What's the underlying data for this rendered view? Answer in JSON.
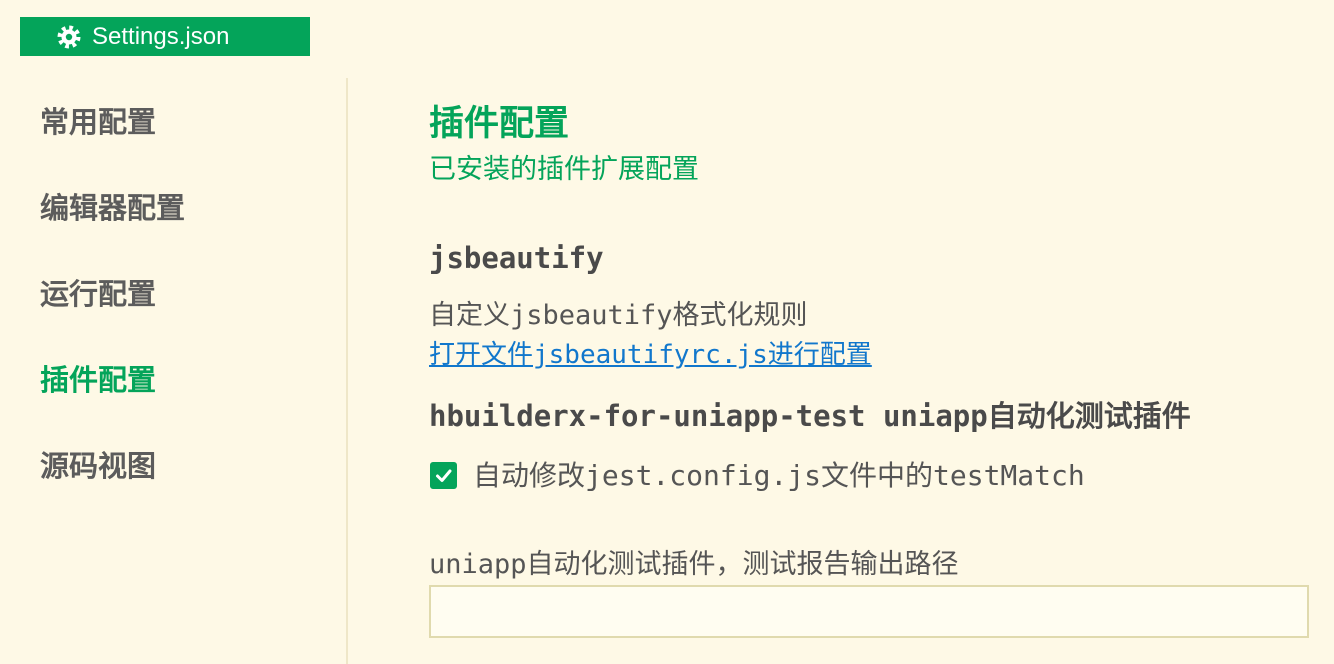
{
  "tab": {
    "title": "Settings.json",
    "icon": "gear-icon"
  },
  "sidebar": {
    "items": [
      {
        "label": "常用配置",
        "active": false
      },
      {
        "label": "编辑器配置",
        "active": false
      },
      {
        "label": "运行配置",
        "active": false
      },
      {
        "label": "插件配置",
        "active": true
      },
      {
        "label": "源码视图",
        "active": false
      }
    ]
  },
  "main": {
    "title": "插件配置",
    "subtitle": "已安装的插件扩展配置",
    "plugins": [
      {
        "name": "jsbeautify",
        "description": "自定义jsbeautify格式化规则",
        "link_text": "打开文件jsbeautifyrc.js进行配置"
      },
      {
        "name": "hbuilderx-for-uniapp-test",
        "display_name": "uniapp自动化测试插件",
        "checkbox": {
          "label": "自动修改jest.config.js文件中的testMatch",
          "checked": true,
          "icon": "checkmark-icon"
        },
        "field": {
          "label": "uniapp自动化测试插件，测试报告输出路径",
          "value": ""
        }
      }
    ]
  },
  "colors": {
    "accent": "#04a45a",
    "link": "#1177cc",
    "background": "#fef9e6",
    "text": "#555555"
  }
}
